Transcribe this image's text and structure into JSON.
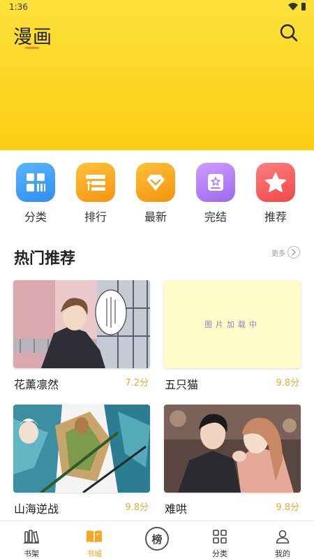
{
  "status_bar": {
    "time": "1:36",
    "icons": [
      "wifi-icon",
      "battery-icon"
    ]
  },
  "header": {
    "title": "漫画",
    "search_icon": "search-icon",
    "accent": "#fcd523",
    "underline_color": "#f18a2a"
  },
  "categories": [
    {
      "label": "分类",
      "icon": "grid-icon",
      "color": "#3aa0f5"
    },
    {
      "label": "排行",
      "icon": "ranking-icon",
      "color": "#f9a51c"
    },
    {
      "label": "最新",
      "icon": "diamond-icon",
      "color": "#f7a41b"
    },
    {
      "label": "完结",
      "icon": "book-star-icon",
      "color": "#b37cf0"
    },
    {
      "label": "推荐",
      "icon": "star-icon",
      "color": "#f45b5b"
    }
  ],
  "hot": {
    "title": "热门推荐",
    "more_label": "更多",
    "items": [
      {
        "title": "花薰凛然",
        "score": "7.2分",
        "cover": "manga-boy-cover"
      },
      {
        "title": "五只猫",
        "score": "9.8分",
        "cover": "loading-placeholder",
        "placeholder_text": "图片加载中"
      },
      {
        "title": "山海逆战",
        "score": "9.8分",
        "cover": "warriors-cover"
      },
      {
        "title": "难哄",
        "score": "9.8分",
        "cover": "couple-cover"
      }
    ]
  },
  "tabbar": {
    "items": [
      {
        "label": "书架",
        "icon": "bookshelf-icon",
        "active": false
      },
      {
        "label": "书城",
        "icon": "open-book-icon",
        "active": true
      },
      {
        "label": "",
        "icon": "ranking-badge-icon",
        "badge_text": "榜",
        "active": false
      },
      {
        "label": "分类",
        "icon": "category-grid-icon",
        "active": false
      },
      {
        "label": "我的",
        "icon": "profile-icon",
        "active": false
      }
    ],
    "active_color": "#f0a020"
  }
}
